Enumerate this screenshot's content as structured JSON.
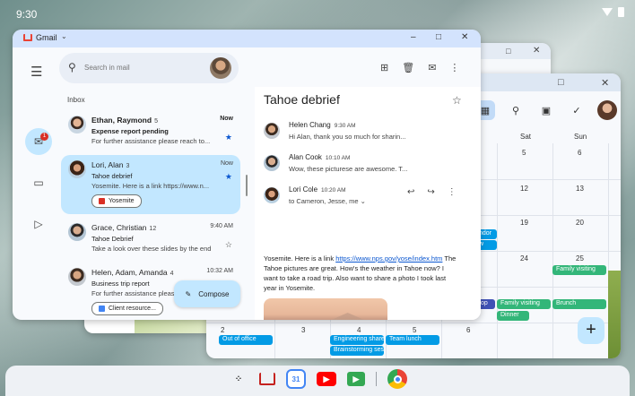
{
  "status": {
    "time": "9:30"
  },
  "gmail": {
    "app_name": "Gmail",
    "search_placeholder": "Search in mail",
    "inbox_label": "Inbox",
    "rail_badge": "1",
    "compose_label": "Compose",
    "emails": [
      {
        "from": "Ethan, Raymond",
        "count": "5",
        "time": "Now",
        "subject": "Expense report pending",
        "snippet": "For further assistance please reach to...",
        "unread": true,
        "starred": true,
        "selected": false
      },
      {
        "from": "Lori, Alan",
        "count": "3",
        "time": "Now",
        "subject": "Tahoe debrief",
        "snippet": "Yosemite. Here is a link https://www.n...",
        "unread": false,
        "starred": true,
        "selected": true,
        "chip": "Yosemite"
      },
      {
        "from": "Grace, Christian",
        "count": "12",
        "time": "9:40 AM",
        "subject": "Tahoe Debrief",
        "snippet": "Take a look over these slides by the end",
        "unread": false,
        "starred": false,
        "selected": false
      },
      {
        "from": "Helen, Adam, Amanda",
        "count": "4",
        "time": "10:32 AM",
        "subject": "Business trip report",
        "snippet": "For further assistance please reach to...",
        "unread": false,
        "starred": false,
        "selected": false,
        "chip": "Client resource..."
      }
    ],
    "reader": {
      "subject": "Tahoe debrief",
      "messages": [
        {
          "sender": "Helen Chang",
          "time": "9:30 AM",
          "snippet": "Hi Alan, thank you so much for sharin..."
        },
        {
          "sender": "Alan Cook",
          "time": "10:10 AM",
          "snippet": "Wow, these picturese are awesome. T..."
        },
        {
          "sender": "Lori Cole",
          "time": "10:20 AM",
          "recipients": "to Cameron, Jesse, me"
        }
      ],
      "body_pre": "Yosemite. Here is a link ",
      "body_link": "https://www.nps.gov/yose/index.htm",
      "body_post": " The Tahoe pictures are great. How's the weather in Tahoe now? I want to take a road trip. Also want to share a photo I took last year in Yosemite."
    }
  },
  "calendar": {
    "day_headers": [
      "Sat",
      "Sun"
    ],
    "dates": [
      "5",
      "6",
      "12",
      "13",
      "19",
      "20",
      "24",
      "25",
      "2",
      "3",
      "4",
      "5",
      "6"
    ],
    "events": [
      "ndor",
      "w",
      "Family visiting",
      "top",
      "Family visiting",
      "Brunch",
      "Dinner",
      "Out of office",
      "Engineering share",
      "Team lunch",
      "Brainstorming ses"
    ],
    "fab_label": "+"
  },
  "icons": [
    "search-icon",
    "menu-icon",
    "archive-icon",
    "delete-icon",
    "mail-icon",
    "more-icon",
    "star-icon",
    "reply-icon",
    "forward-icon",
    "pencil-icon"
  ]
}
